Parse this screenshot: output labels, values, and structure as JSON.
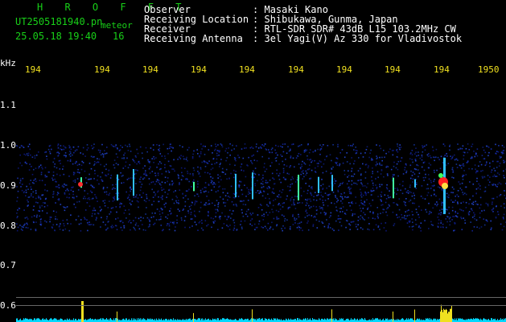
{
  "brand": "H R O F F T",
  "file_name": "UT2505181940.pn",
  "meteor_label": "meteor",
  "date_time": "25.05.18 19:40",
  "meteor_count": "16",
  "info": [
    {
      "label": "Observer",
      "value": "Masaki Kano"
    },
    {
      "label": "Receiving Location",
      "value": "Shibukawa, Gunma, Japan"
    },
    {
      "label": "Receiver",
      "value": "RTL-SDR SDR# 43dB L15 103.2MHz CW"
    },
    {
      "label": "Receiving Antenna",
      "value": "3el Yagi(V) Az 330 for Vladivostok"
    }
  ],
  "separator": ":",
  "y_unit": "kHz",
  "y_ticks": [
    "1.1",
    "1.0",
    "0.9",
    "0.8",
    "0.7",
    "0.6"
  ],
  "x_ticks": [
    "194",
    "194",
    "194",
    "194",
    "194",
    "194",
    "194",
    "194",
    "194",
    "1950"
  ],
  "colors": {
    "brand": "#18d018",
    "ticks": "#f0e020",
    "text": "#ffffff",
    "profile": "#00e0ff",
    "background": "#000000"
  }
}
